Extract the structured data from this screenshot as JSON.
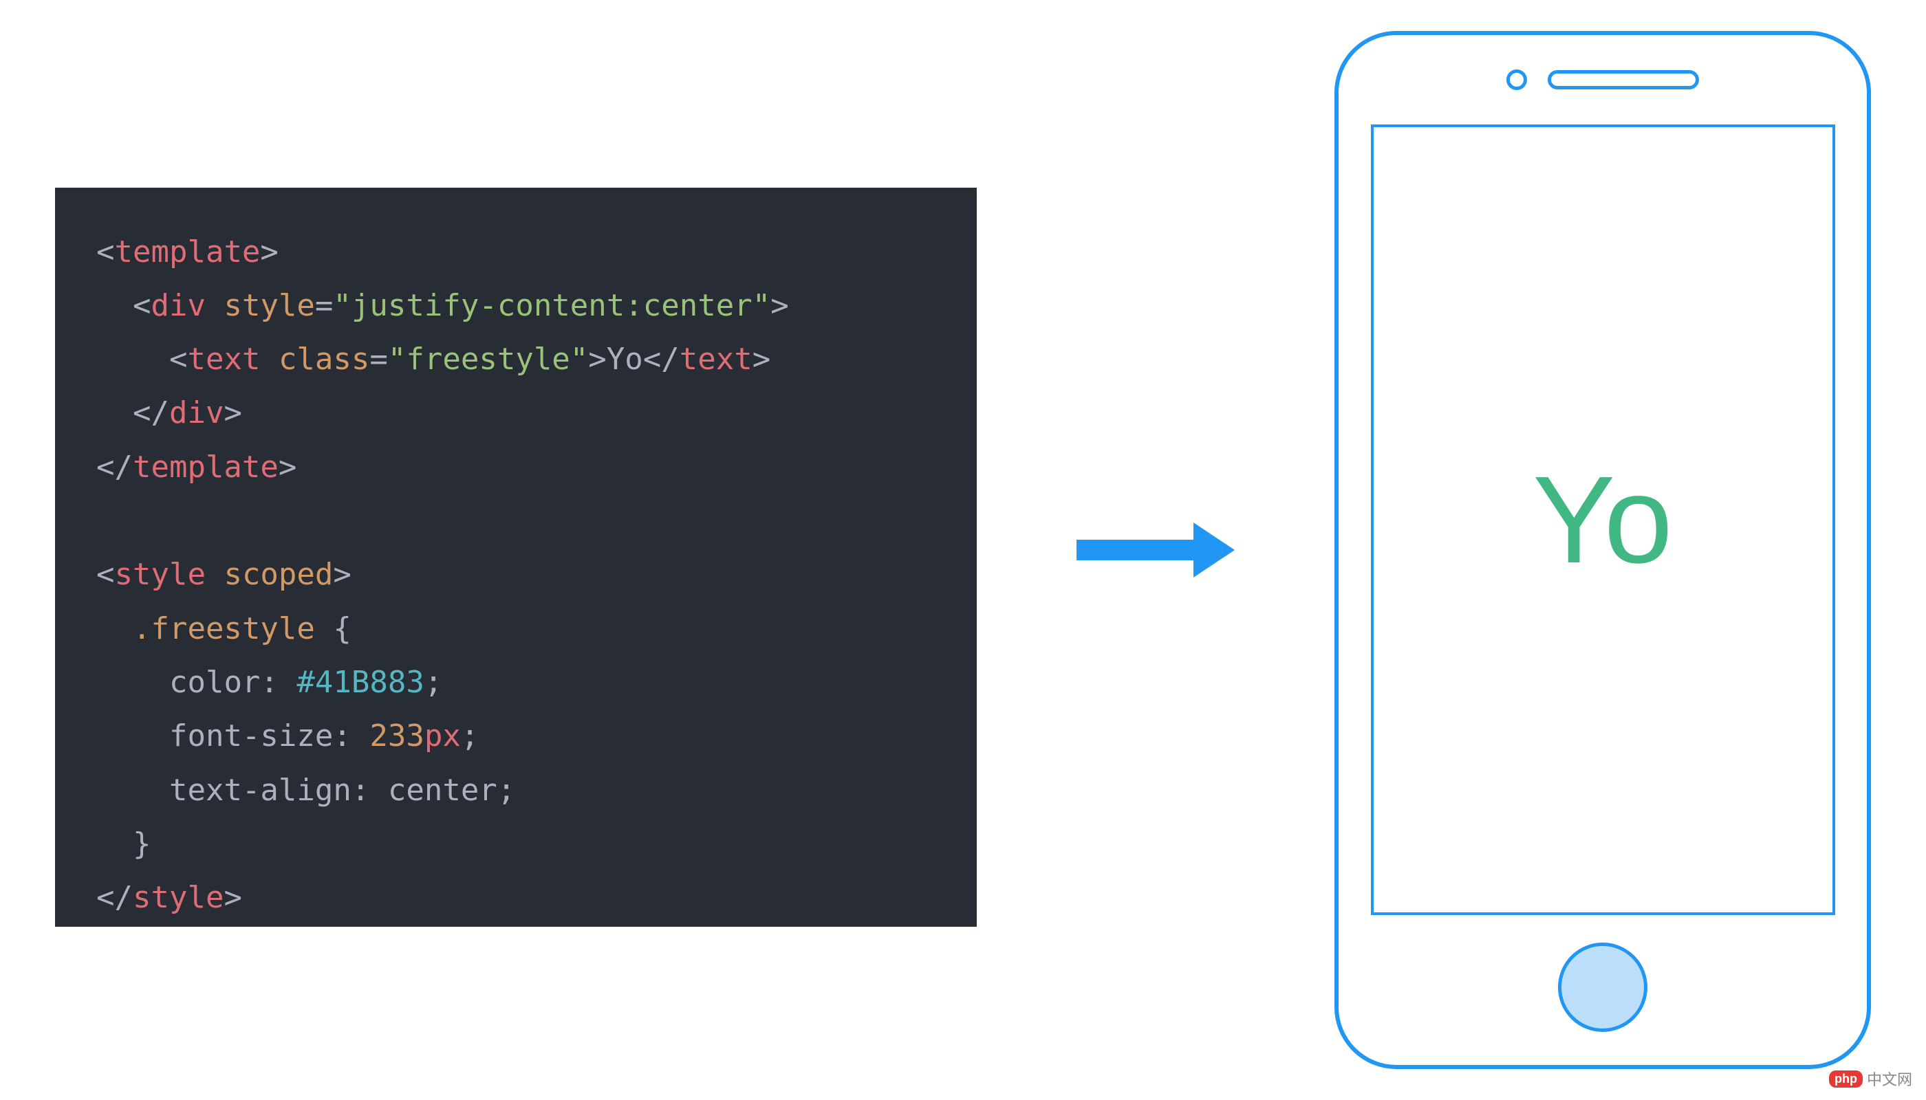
{
  "code": {
    "lines": [
      [
        {
          "cls": "punct",
          "t": "<"
        },
        {
          "cls": "tag",
          "t": "template"
        },
        {
          "cls": "punct",
          "t": ">"
        }
      ],
      [
        {
          "cls": "guide",
          "t": "  "
        },
        {
          "cls": "punct",
          "t": "<"
        },
        {
          "cls": "tag",
          "t": "div"
        },
        {
          "cls": "punct",
          "t": " "
        },
        {
          "cls": "attr",
          "t": "style"
        },
        {
          "cls": "punct",
          "t": "="
        },
        {
          "cls": "string",
          "t": "\"justify-content:center\""
        },
        {
          "cls": "punct",
          "t": ">"
        }
      ],
      [
        {
          "cls": "guide",
          "t": "    "
        },
        {
          "cls": "punct",
          "t": "<"
        },
        {
          "cls": "tag",
          "t": "text"
        },
        {
          "cls": "punct",
          "t": " "
        },
        {
          "cls": "attr",
          "t": "class"
        },
        {
          "cls": "punct",
          "t": "="
        },
        {
          "cls": "string",
          "t": "\"freestyle\""
        },
        {
          "cls": "punct",
          "t": ">"
        },
        {
          "cls": "text-content",
          "t": "Yo"
        },
        {
          "cls": "punct",
          "t": "</"
        },
        {
          "cls": "tag",
          "t": "text"
        },
        {
          "cls": "punct",
          "t": ">"
        }
      ],
      [
        {
          "cls": "guide",
          "t": "  "
        },
        {
          "cls": "punct",
          "t": "</"
        },
        {
          "cls": "tag",
          "t": "div"
        },
        {
          "cls": "punct",
          "t": ">"
        }
      ],
      [
        {
          "cls": "punct",
          "t": "</"
        },
        {
          "cls": "tag",
          "t": "template"
        },
        {
          "cls": "punct",
          "t": ">"
        }
      ],
      [
        {
          "cls": "punct",
          "t": " "
        }
      ],
      [
        {
          "cls": "punct",
          "t": "<"
        },
        {
          "cls": "tag",
          "t": "style"
        },
        {
          "cls": "punct",
          "t": " "
        },
        {
          "cls": "attr",
          "t": "scoped"
        },
        {
          "cls": "punct",
          "t": ">"
        }
      ],
      [
        {
          "cls": "guide",
          "t": "  "
        },
        {
          "cls": "selector",
          "t": ".freestyle"
        },
        {
          "cls": "punct",
          "t": " {"
        }
      ],
      [
        {
          "cls": "guide",
          "t": "    "
        },
        {
          "cls": "prop",
          "t": "color"
        },
        {
          "cls": "punct",
          "t": ": "
        },
        {
          "cls": "value-hex",
          "t": "#41B883"
        },
        {
          "cls": "punct",
          "t": ";"
        }
      ],
      [
        {
          "cls": "guide",
          "t": "    "
        },
        {
          "cls": "prop",
          "t": "font-size"
        },
        {
          "cls": "punct",
          "t": ": "
        },
        {
          "cls": "value-num",
          "t": "233"
        },
        {
          "cls": "value-unit",
          "t": "px"
        },
        {
          "cls": "punct",
          "t": ";"
        }
      ],
      [
        {
          "cls": "guide",
          "t": "    "
        },
        {
          "cls": "prop",
          "t": "text-align"
        },
        {
          "cls": "punct",
          "t": ": "
        },
        {
          "cls": "value-ident",
          "t": "center"
        },
        {
          "cls": "punct",
          "t": ";"
        }
      ],
      [
        {
          "cls": "guide",
          "t": "  "
        },
        {
          "cls": "punct",
          "t": "}"
        }
      ],
      [
        {
          "cls": "punct",
          "t": "</"
        },
        {
          "cls": "tag",
          "t": "style"
        },
        {
          "cls": "punct",
          "t": ">"
        }
      ]
    ]
  },
  "render": {
    "text": "Yo",
    "color": "#41B883"
  },
  "watermark": {
    "badge": "php",
    "text": "中文网"
  }
}
